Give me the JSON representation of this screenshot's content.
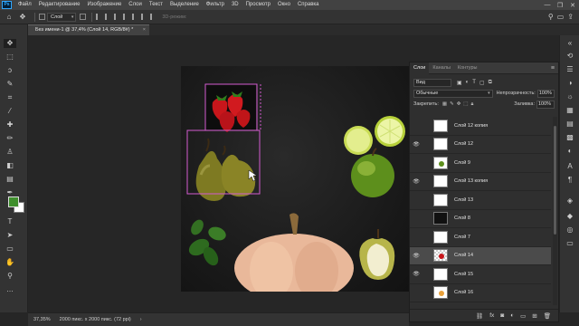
{
  "app": {
    "logo_text": "Ps",
    "menu": [
      "Файл",
      "Редактирование",
      "Изображение",
      "Слои",
      "Текст",
      "Выделение",
      "Фильтр",
      "3D",
      "Просмотр",
      "Окно",
      "Справка"
    ],
    "window_controls": [
      "—",
      "❐",
      "✕"
    ]
  },
  "options_bar": {
    "auto_select_value": "Слой",
    "mode_3d_label": "3D-режим:",
    "icons": [
      "home-icon",
      "move-icon",
      "auto-select-icon",
      "align-icons",
      "search-icon",
      "workspace-icon",
      "share-icon"
    ]
  },
  "document": {
    "tab_title": "Без имени-1 @ 37,4% (Слой 14, RGB/8#) *",
    "close": "×"
  },
  "colors": {
    "foreground": "#3f8f2d",
    "background": "#ffffff",
    "selection": "#d35bd0",
    "ui_dark": "#262626"
  },
  "layers_panel": {
    "tabs": [
      "Слои",
      "Каналы",
      "Контуры"
    ],
    "active_tab": 0,
    "search_value": "Вид",
    "blend_mode": "Обычные",
    "opacity_label": "Непрозрачность:",
    "opacity_value": "100%",
    "lock_label": "Закрепить:",
    "fill_label": "Заливка:",
    "fill_value": "100%",
    "layers": [
      {
        "name": "Слой 12 копия",
        "visible": false,
        "thumb": "white"
      },
      {
        "name": "Слой 12",
        "visible": true,
        "thumb": "white"
      },
      {
        "name": "Слой 9",
        "visible": false,
        "thumb": "white"
      },
      {
        "name": "Слой 13 копия",
        "visible": true,
        "thumb": "white"
      },
      {
        "name": "Слой 13",
        "visible": false,
        "thumb": "white"
      },
      {
        "name": "Слой 8",
        "visible": false,
        "thumb": "dark"
      },
      {
        "name": "Слой 7",
        "visible": false,
        "thumb": "white"
      },
      {
        "name": "Слой 14",
        "visible": true,
        "thumb": "checker",
        "selected": true
      },
      {
        "name": "Слой 15",
        "visible": true,
        "thumb": "white"
      },
      {
        "name": "Слой 16",
        "visible": false,
        "thumb": "white"
      }
    ],
    "footer_icons": [
      "link-icon",
      "fx-icon",
      "mask-icon",
      "adjustment-icon",
      "folder-icon",
      "new-layer-icon",
      "trash-icon"
    ]
  },
  "status_bar": {
    "zoom": "37,35%",
    "doc_info": "2000 пикс. x 2000 пикс. (72 ppi)",
    "arrow": "›"
  }
}
